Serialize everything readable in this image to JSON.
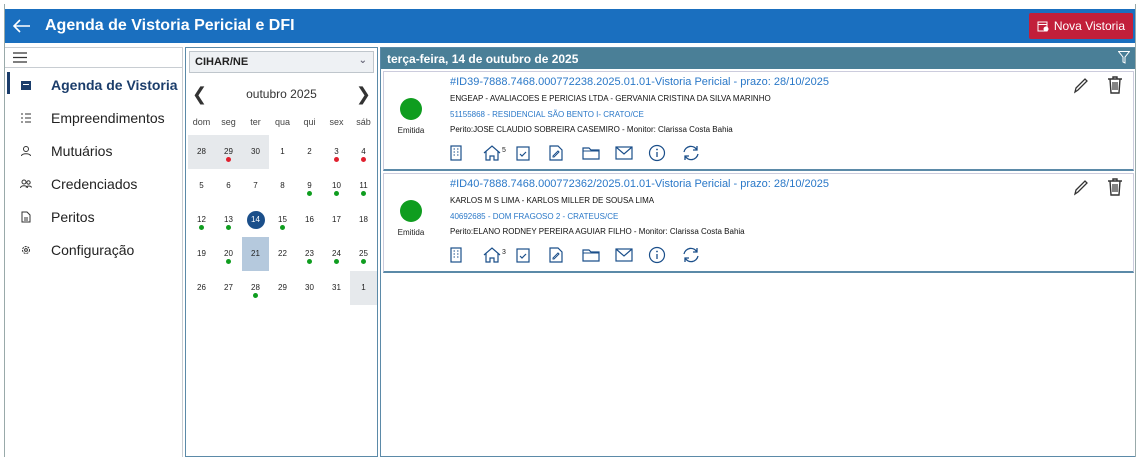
{
  "header": {
    "title": "Agenda de Vistoria Pericial e DFI",
    "new_button": "Nova Vistoria"
  },
  "sidebar": {
    "items": [
      {
        "label": "Agenda de Vistoria",
        "icon": "calendar-icon",
        "active": true
      },
      {
        "label": "Empreendimentos",
        "icon": "list-icon"
      },
      {
        "label": "Mutuários",
        "icon": "user-icon"
      },
      {
        "label": "Credenciados",
        "icon": "users-icon"
      },
      {
        "label": "Peritos",
        "icon": "document-icon"
      },
      {
        "label": "Configuração",
        "icon": "gear-icon"
      }
    ]
  },
  "calendar": {
    "selected_group": "CIHAR/NE",
    "month_label": "outubro 2025",
    "weekdays": [
      "dom",
      "seg",
      "ter",
      "qua",
      "qui",
      "sex",
      "sáb"
    ],
    "weeks": [
      [
        {
          "d": "28",
          "other": true
        },
        {
          "d": "29",
          "other": true,
          "dot": "red"
        },
        {
          "d": "30",
          "other": true
        },
        {
          "d": "1"
        },
        {
          "d": "2"
        },
        {
          "d": "3",
          "dot": "red"
        },
        {
          "d": "4",
          "dot": "red"
        }
      ],
      [
        {
          "d": "5"
        },
        {
          "d": "6"
        },
        {
          "d": "7"
        },
        {
          "d": "8"
        },
        {
          "d": "9",
          "dot": "green"
        },
        {
          "d": "10",
          "dot": "green"
        },
        {
          "d": "11",
          "dot": "green"
        }
      ],
      [
        {
          "d": "12",
          "dot": "green"
        },
        {
          "d": "13",
          "dot": "green"
        },
        {
          "d": "14",
          "today": true
        },
        {
          "d": "15",
          "dot": "green"
        },
        {
          "d": "16"
        },
        {
          "d": "17"
        },
        {
          "d": "18"
        }
      ],
      [
        {
          "d": "19"
        },
        {
          "d": "20",
          "dot": "green"
        },
        {
          "d": "21",
          "sel": true
        },
        {
          "d": "22"
        },
        {
          "d": "23",
          "dot": "green"
        },
        {
          "d": "24",
          "dot": "green"
        },
        {
          "d": "25",
          "dot": "green"
        }
      ],
      [
        {
          "d": "26"
        },
        {
          "d": "27"
        },
        {
          "d": "28",
          "dot": "green"
        },
        {
          "d": "29"
        },
        {
          "d": "30"
        },
        {
          "d": "31"
        },
        {
          "d": "1",
          "other": true
        }
      ]
    ]
  },
  "main": {
    "date_header": "terça-feira, 14 de outubro de 2025",
    "cards": [
      {
        "title": "#ID39-7888.7468.000772238.2025.01.01-Vistoria Pericial - prazo: 28/10/2025",
        "companies": "ENGEAP - AVALIACOES E PERICIAS LTDA - GERVANIA CRISTINA DA SILVA MARINHO",
        "property": "51155868 - RESIDENCIAL SÃO BENTO I- CRATO/CE",
        "perito": "Perito:JOSE CLAUDIO SOBREIRA CASEMIRO - Monitor: Clarissa Costa Bahia",
        "status": "Emitida",
        "home_count": "5"
      },
      {
        "title": "#ID40-7888.7468.000772362/2025.01.01-Vistoria Pericial - prazo: 28/10/2025",
        "companies": "KARLOS M S LIMA - KARLOS MILLER DE SOUSA LIMA",
        "property": "40692685 - DOM FRAGOSO 2 - CRATEUS/CE",
        "perito": "Perito:ELANO RODNEY PEREIRA AGUIAR FILHO - Monitor: Clarissa Costa Bahia",
        "status": "Emitida",
        "home_count": "3"
      }
    ]
  },
  "colors": {
    "primary": "#1a6fbf",
    "danger": "#c21f3a",
    "status_green": "#0f9d1f",
    "dot_red": "#e0202e",
    "dot_green": "#0f9d1f"
  }
}
